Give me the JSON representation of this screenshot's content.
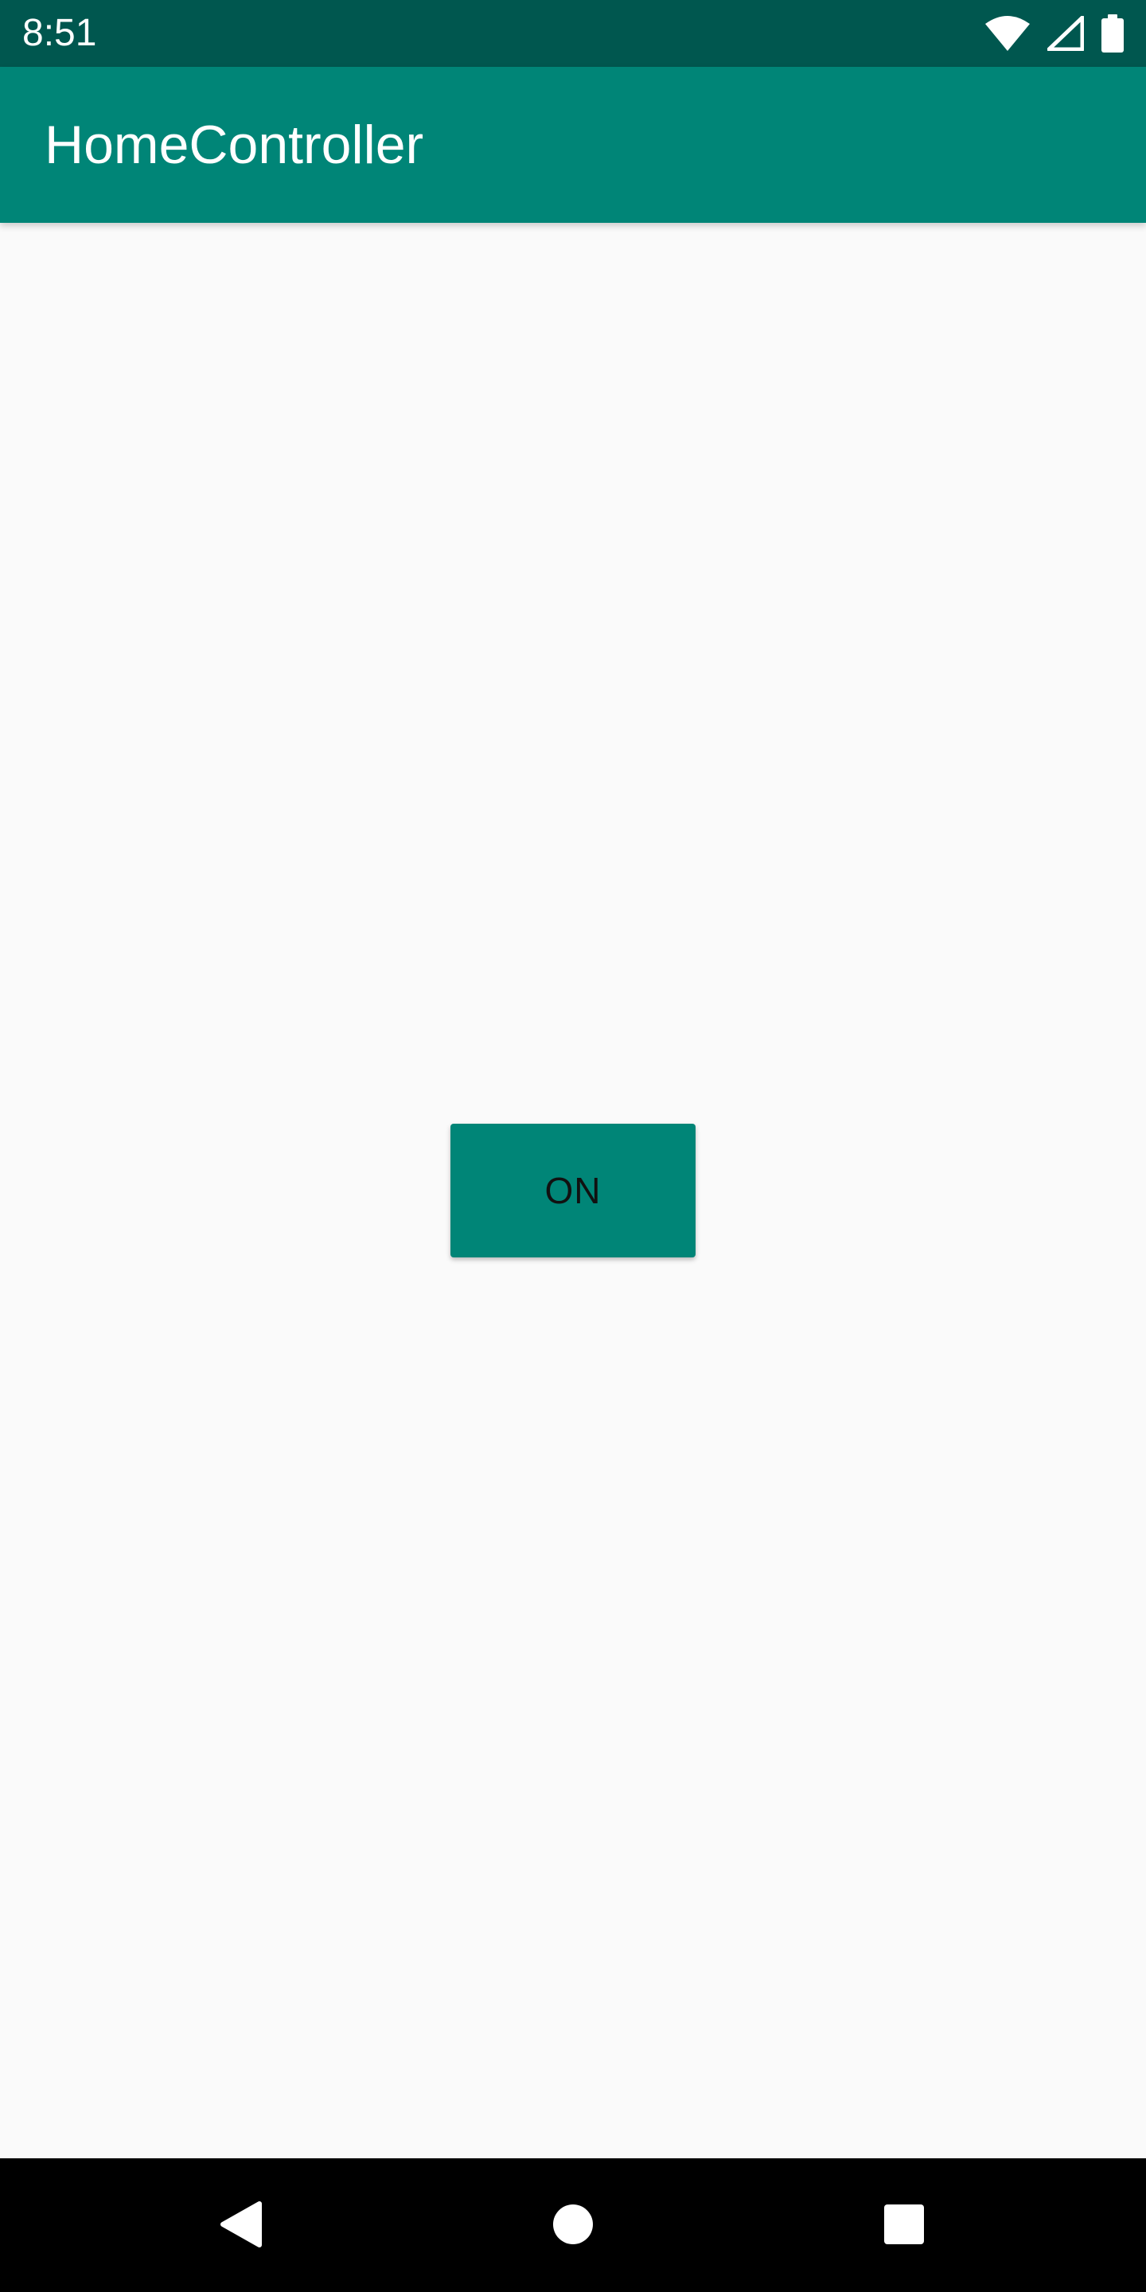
{
  "status_bar": {
    "time": "8:51",
    "icons": [
      "wifi-icon",
      "cellular-signal-icon",
      "battery-icon"
    ]
  },
  "app_bar": {
    "title": "HomeController"
  },
  "main": {
    "toggle_button_label": "ON"
  },
  "nav_bar": {
    "buttons": [
      "back-icon",
      "home-icon",
      "recents-icon"
    ]
  },
  "colors": {
    "status_bar": "#00574f",
    "primary": "#008577",
    "background": "#fafafa",
    "nav_bar": "#000000"
  }
}
